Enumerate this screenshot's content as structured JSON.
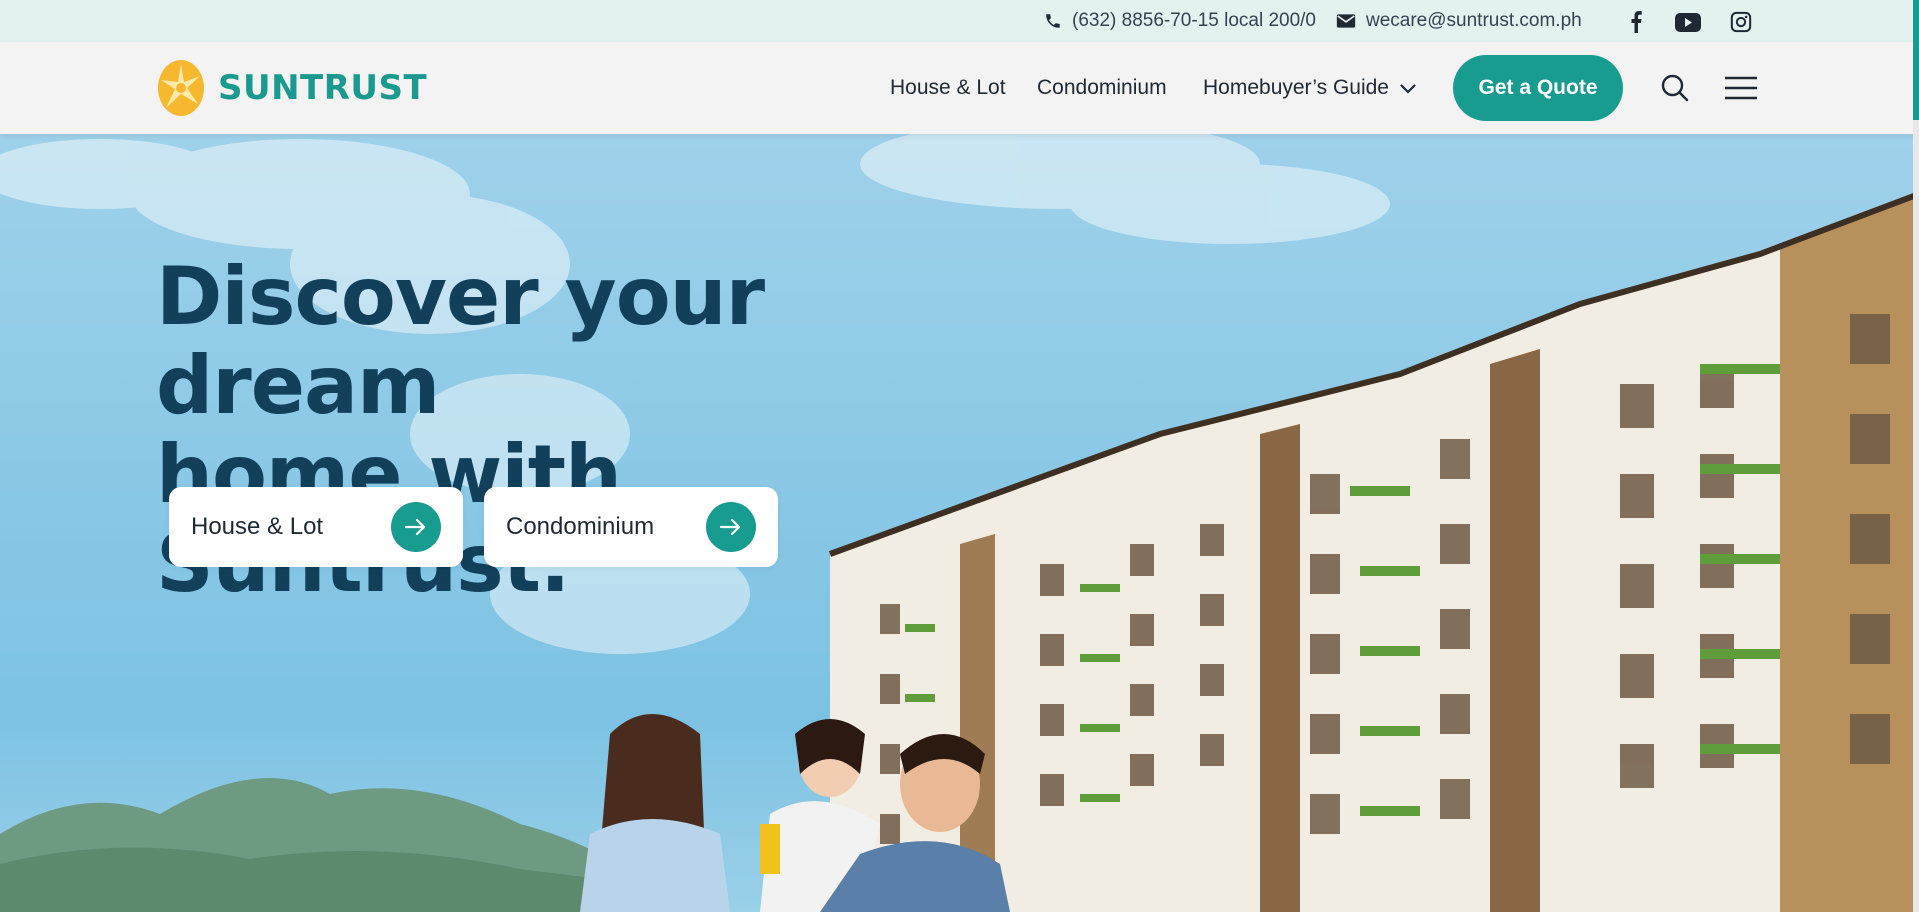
{
  "topbar": {
    "phone": "(632) 8856-70-15 local 200/0",
    "email": "wecare@suntrust.com.ph",
    "social": [
      "facebook-icon",
      "youtube-icon",
      "instagram-icon"
    ]
  },
  "header": {
    "logo_text": "SUNTRUST",
    "nav": {
      "house_lot": "House & Lot",
      "condominium": "Condominium",
      "homebuyers_guide": "Homebuyer’s Guide"
    },
    "cta": "Get a Quote"
  },
  "hero": {
    "title_line1": "Discover your dream",
    "title_line2": "home with Suntrust.",
    "cards": [
      {
        "label": "House & Lot"
      },
      {
        "label": "Condominium"
      }
    ]
  },
  "colors": {
    "brand_teal": "#179c8f",
    "logo_yellow": "#f5b82e",
    "title_navy": "#12405a",
    "topbar_bg": "#e3f2ef"
  }
}
